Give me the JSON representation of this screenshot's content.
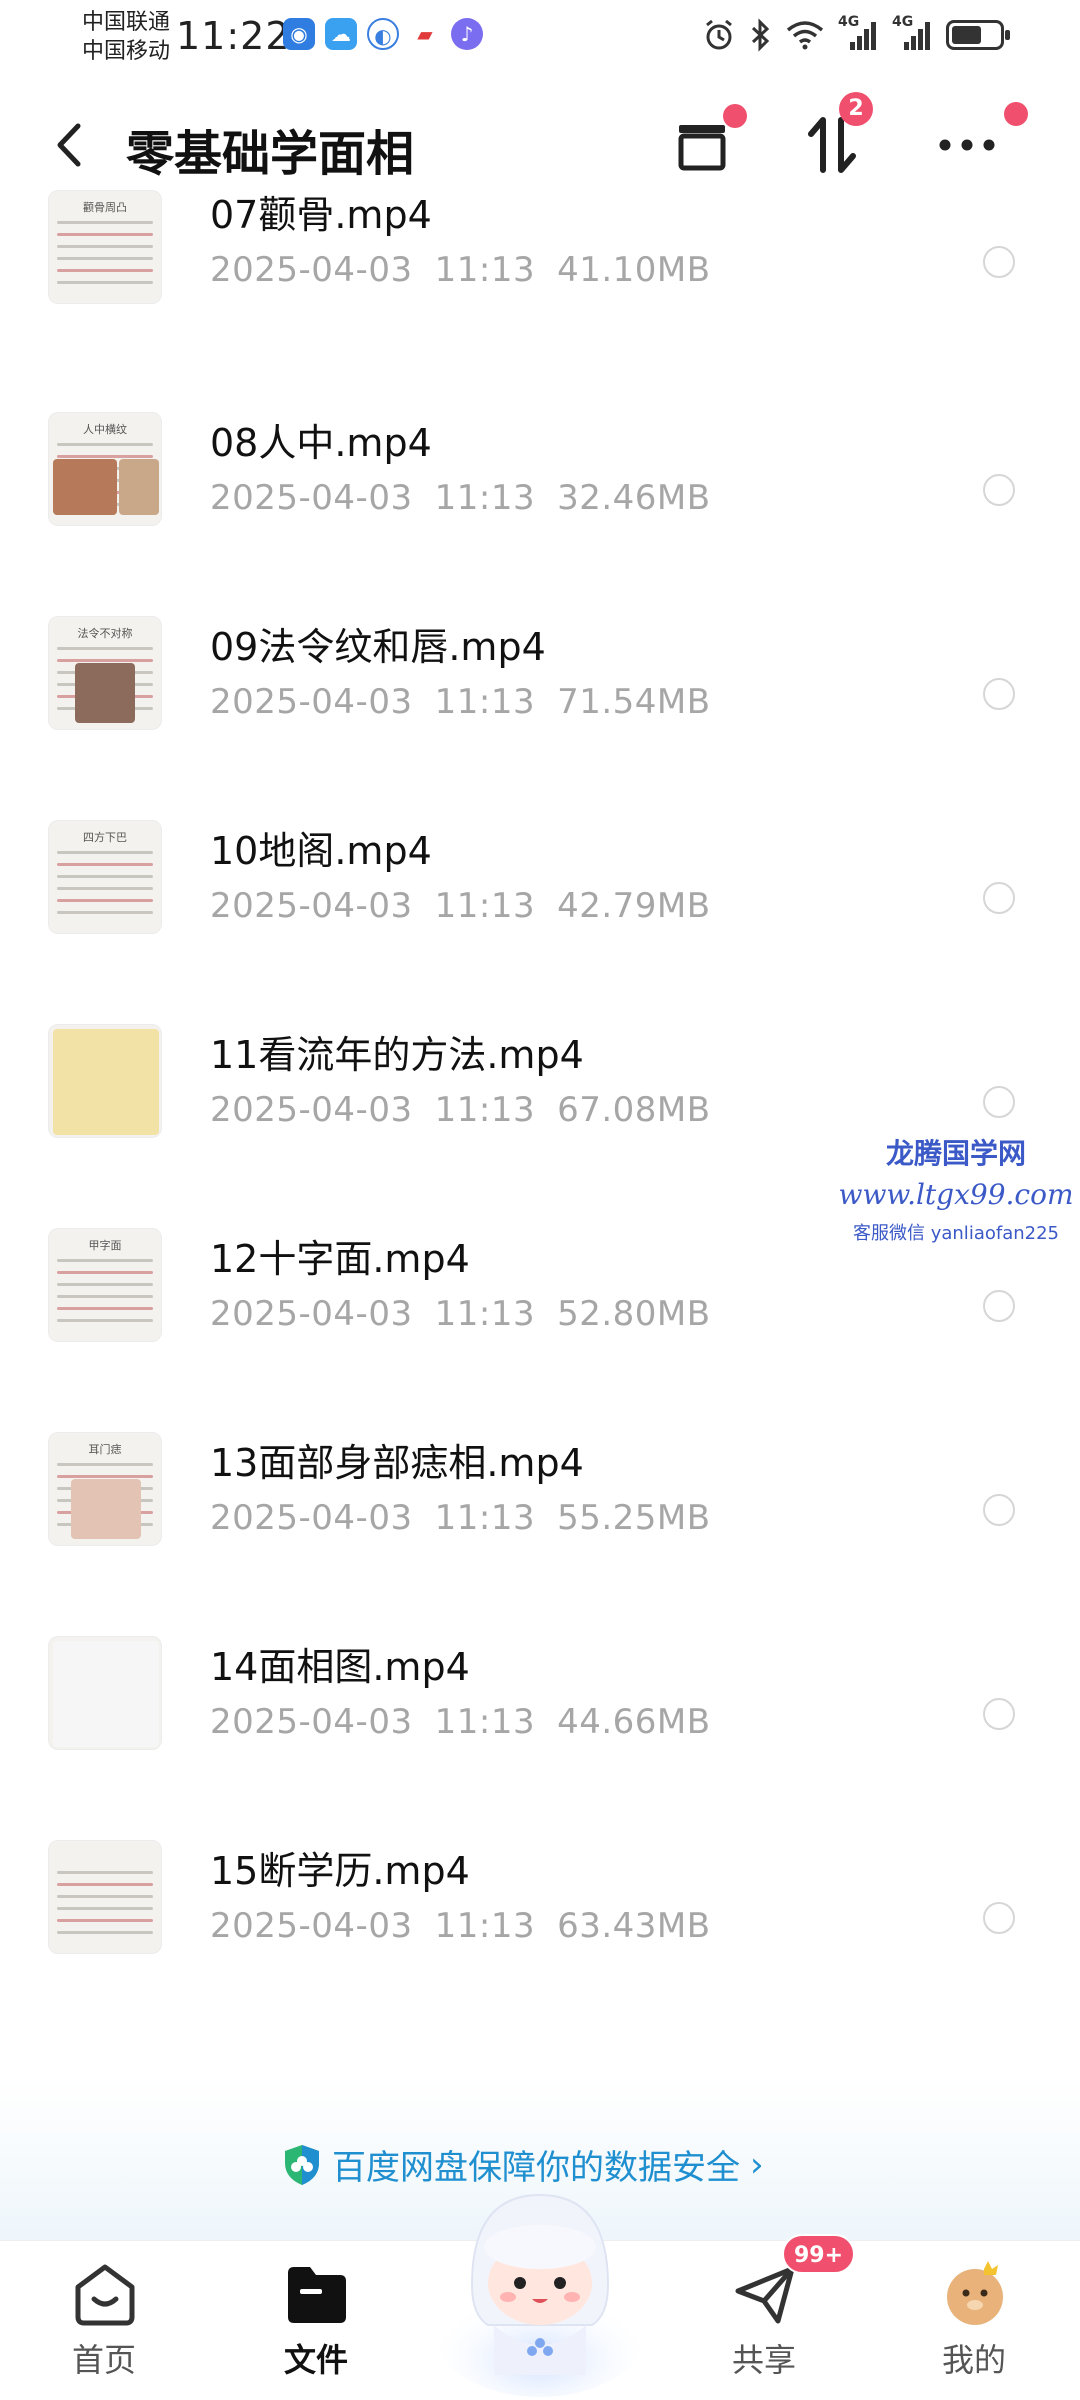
{
  "status_bar": {
    "carrier_1": "中国联通",
    "carrier_2": "中国移动",
    "time": "11:22",
    "network_1": "4G",
    "network_2": "4G",
    "battery_level": 0.55,
    "notification_icons": [
      "shield-app-icon",
      "weather-app-icon",
      "browser-app-icon",
      "book-app-icon",
      "music-app-icon"
    ]
  },
  "nav_bar": {
    "title": "零基础学面相",
    "sort_badge": "2"
  },
  "files": [
    {
      "name": "07颧骨.mp4",
      "date": "2025-04-03",
      "time": "11:13",
      "size": "41.10MB"
    },
    {
      "name": "08人中.mp4",
      "date": "2025-04-03",
      "time": "11:13",
      "size": "32.46MB"
    },
    {
      "name": "09法令纹和唇.mp4",
      "date": "2025-04-03",
      "time": "11:13",
      "size": "71.54MB"
    },
    {
      "name": "10地阁.mp4",
      "date": "2025-04-03",
      "time": "11:13",
      "size": "42.79MB"
    },
    {
      "name": "11看流年的方法.mp4",
      "date": "2025-04-03",
      "time": "11:13",
      "size": "67.08MB"
    },
    {
      "name": "12十字面.mp4",
      "date": "2025-04-03",
      "time": "11:13",
      "size": "52.80MB"
    },
    {
      "name": "13面部身部痣相.mp4",
      "date": "2025-04-03",
      "time": "11:13",
      "size": "55.25MB"
    },
    {
      "name": "14面相图.mp4",
      "date": "2025-04-03",
      "time": "11:13",
      "size": "44.66MB"
    },
    {
      "name": "15断学历.mp4",
      "date": "2025-04-03",
      "time": "11:13",
      "size": "63.43MB"
    }
  ],
  "thumbnails": [
    {
      "caption": "颧骨周凸"
    },
    {
      "caption": "人中横纹"
    },
    {
      "caption": "法令不对称"
    },
    {
      "caption": "四方下巴"
    },
    {
      "caption": ""
    },
    {
      "caption": "甲字面"
    },
    {
      "caption": "耳门痣"
    },
    {
      "caption": ""
    },
    {
      "caption": ""
    }
  ],
  "watermark": {
    "title": "龙腾国学网",
    "url": "www.ltgx99.com",
    "contact": "客服微信 yanliaofan225"
  },
  "security_banner": {
    "text": "百度网盘保障你的数据安全",
    "chevron": "›"
  },
  "bottom_nav": {
    "tabs": [
      {
        "label": "首页",
        "icon": "home-icon"
      },
      {
        "label": "文件",
        "icon": "folder-icon"
      },
      {
        "label": "共享",
        "icon": "share-icon"
      },
      {
        "label": "我的",
        "icon": "profile-avatar-icon"
      }
    ],
    "share_badge": "99+"
  },
  "colors": {
    "accent_blue": "#1f8fd0",
    "badge_red": "#f0506e",
    "meta_gray": "#a6a6a6",
    "watermark_blue": "#3b59c7"
  }
}
